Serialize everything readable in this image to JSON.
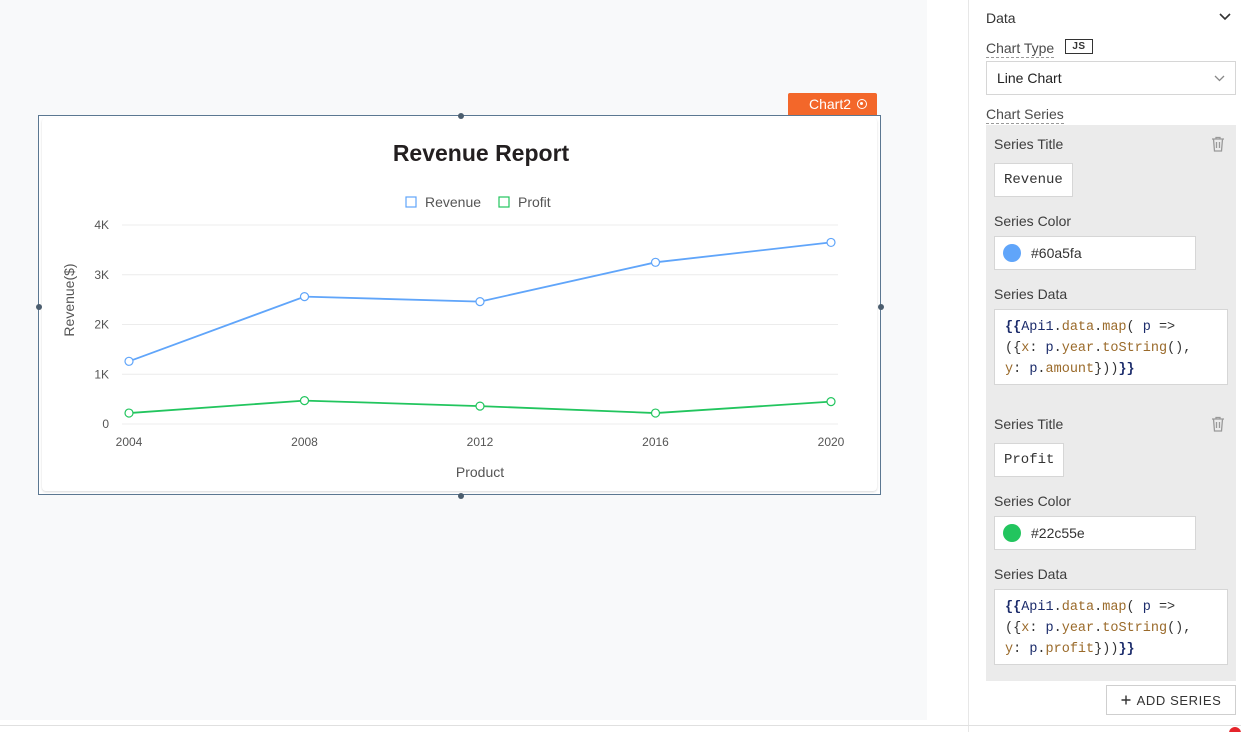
{
  "widget": {
    "tag_label": "Chart2"
  },
  "chart_data": {
    "type": "line",
    "title": "Revenue Report",
    "xlabel": "Product",
    "ylabel": "Revenue($)",
    "categories": [
      "2004",
      "2008",
      "2012",
      "2016",
      "2020"
    ],
    "y_ticks": [
      "0",
      "1K",
      "2K",
      "3K",
      "4K"
    ],
    "ylim": [
      0,
      4000
    ],
    "grid": true,
    "legend_position": "top",
    "series": [
      {
        "name": "Revenue",
        "color": "#60a5fa",
        "values": [
          1260,
          2560,
          2460,
          3250,
          3650
        ]
      },
      {
        "name": "Profit",
        "color": "#22c55e",
        "values": [
          220,
          470,
          360,
          220,
          450
        ]
      }
    ]
  },
  "panel": {
    "section_title": "Data",
    "chart_type_label": "Chart Type",
    "js_badge": "JS",
    "chart_type_value": "Line Chart",
    "chart_series_label": "Chart Series",
    "series": [
      {
        "title_label": "Series Title",
        "title_value": "Revenue",
        "color_label": "Series Color",
        "color_value": "#60a5fa",
        "data_label": "Series Data",
        "data_code": {
          "l1_open": "{{",
          "l1_obj": "Api1",
          "l1_dot1": ".",
          "l1_data": "data",
          "l1_dot2": ".",
          "l1_map": "map",
          "l1_paren": "( ",
          "l1_p": "p",
          "l1_arrow": " =>",
          "l2_open": "({",
          "l2_x": "x",
          "l2_colon": ": ",
          "l2_p": "p",
          "l2_dot": ".",
          "l2_year": "year",
          "l2_dot2": ".",
          "l2_tostring": "toString",
          "l2_call": "(),",
          "l3_y": "y",
          "l3_colon": ": ",
          "l3_p": "p",
          "l3_dot": ".",
          "l3_field": "amount",
          "l3_close": "}))",
          "l3_brace": "}}"
        }
      },
      {
        "title_label": "Series Title",
        "title_value": "Profit",
        "color_label": "Series Color",
        "color_value": "#22c55e",
        "data_label": "Series Data",
        "data_code": {
          "l1_open": "{{",
          "l1_obj": "Api1",
          "l1_dot1": ".",
          "l1_data": "data",
          "l1_dot2": ".",
          "l1_map": "map",
          "l1_paren": "( ",
          "l1_p": "p",
          "l1_arrow": " =>",
          "l2_open": "({",
          "l2_x": "x",
          "l2_colon": ": ",
          "l2_p": "p",
          "l2_dot": ".",
          "l2_year": "year",
          "l2_dot2": ".",
          "l2_tostring": "toString",
          "l2_call": "(),",
          "l3_y": "y",
          "l3_colon": ": ",
          "l3_p": "p",
          "l3_dot": ".",
          "l3_field": "profit",
          "l3_close": "}))",
          "l3_brace": "}}"
        }
      }
    ],
    "add_series_label": "ADD SERIES"
  }
}
